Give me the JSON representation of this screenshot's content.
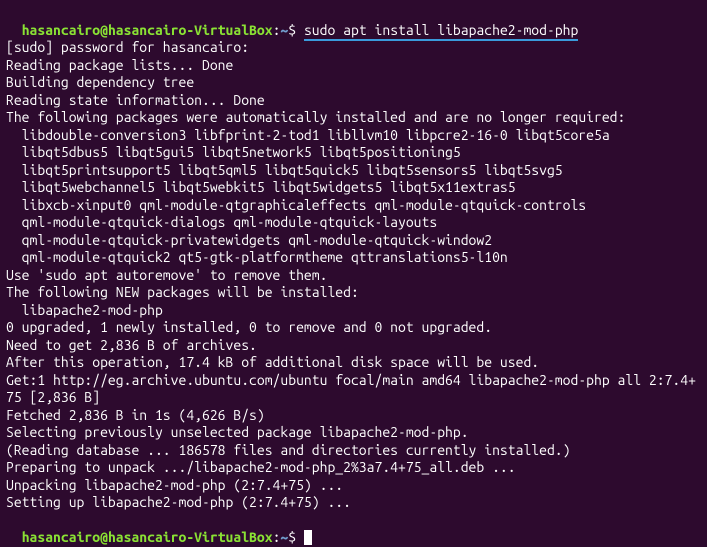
{
  "prompt1": {
    "user": "hasancairo",
    "at": "@",
    "host": "hasancairo-VirtualBox",
    "colon": ":",
    "path": "~",
    "dollar": "$ ",
    "command": "sudo apt install libapache2-mod-php"
  },
  "out": {
    "l01": "[sudo] password for hasancairo:",
    "l02": "Reading package lists... Done",
    "l03": "Building dependency tree",
    "l04": "Reading state information... Done",
    "l05": "The following packages were automatically installed and are no longer required:",
    "l06": "libdouble-conversion3 libfprint-2-tod1 libllvm10 libpcre2-16-0 libqt5core5a",
    "l07": "libqt5dbus5 libqt5gui5 libqt5network5 libqt5positioning5",
    "l08": "libqt5printsupport5 libqt5qml5 libqt5quick5 libqt5sensors5 libqt5svg5",
    "l09": "libqt5webchannel5 libqt5webkit5 libqt5widgets5 libqt5x11extras5",
    "l10": "libxcb-xinput0 qml-module-qtgraphicaleffects qml-module-qtquick-controls",
    "l11": "qml-module-qtquick-dialogs qml-module-qtquick-layouts",
    "l12": "qml-module-qtquick-privatewidgets qml-module-qtquick-window2",
    "l13": "qml-module-qtquick2 qt5-gtk-platformtheme qttranslations5-l10n",
    "l14": "Use 'sudo apt autoremove' to remove them.",
    "l15": "The following NEW packages will be installed:",
    "l16": "libapache2-mod-php",
    "l17": "0 upgraded, 1 newly installed, 0 to remove and 0 not upgraded.",
    "l18": "Need to get 2,836 B of archives.",
    "l19": "After this operation, 17.4 kB of additional disk space will be used.",
    "l20": "Get:1 http://eg.archive.ubuntu.com/ubuntu focal/main amd64 libapache2-mod-php all 2:7.4+75 [2,836 B]",
    "l21": "Fetched 2,836 B in 1s (4,626 B/s)",
    "l22": "Selecting previously unselected package libapache2-mod-php.",
    "l23": "(Reading database ... 186578 files and directories currently installed.)",
    "l24": "Preparing to unpack .../libapache2-mod-php_2%3a7.4+75_all.deb ...",
    "l25": "Unpacking libapache2-mod-php (2:7.4+75) ...",
    "l26": "Setting up libapache2-mod-php (2:7.4+75) ..."
  },
  "prompt2": {
    "user": "hasancairo",
    "at": "@",
    "host": "hasancairo-VirtualBox",
    "colon": ":",
    "path": "~",
    "dollar": "$ "
  }
}
